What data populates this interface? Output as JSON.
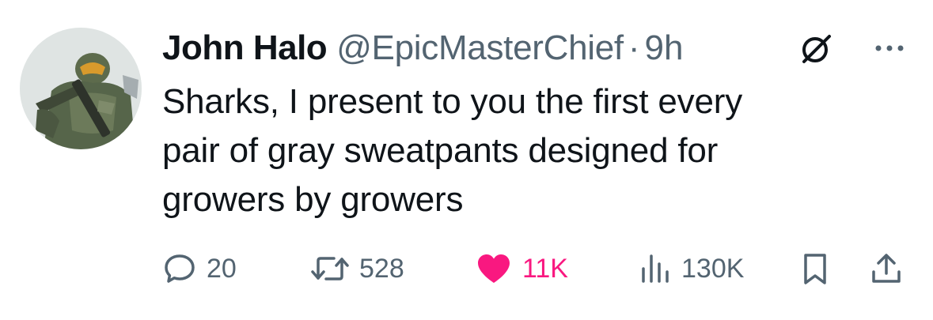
{
  "tweet": {
    "author_name": "John Halo",
    "handle": "@EpicMasterChief",
    "separator": "·",
    "time": "9h",
    "body_lines": [
      "Sharks, I present to you the first every",
      "pair of gray sweatpants designed for",
      "growers by growers"
    ]
  },
  "actions": {
    "replies": "20",
    "retweets": "528",
    "likes": "11K",
    "views": "130K"
  },
  "icons": {
    "avatar": "avatar-master-chief",
    "grok": "grok-icon",
    "more": "more-icon",
    "reply": "reply-icon",
    "retweet": "retweet-icon",
    "like": "heart-icon",
    "views": "views-icon",
    "bookmark": "bookmark-icon",
    "share": "share-icon"
  },
  "colors": {
    "text_primary": "#0f1419",
    "text_secondary": "#536471",
    "like_active": "#f91880"
  }
}
